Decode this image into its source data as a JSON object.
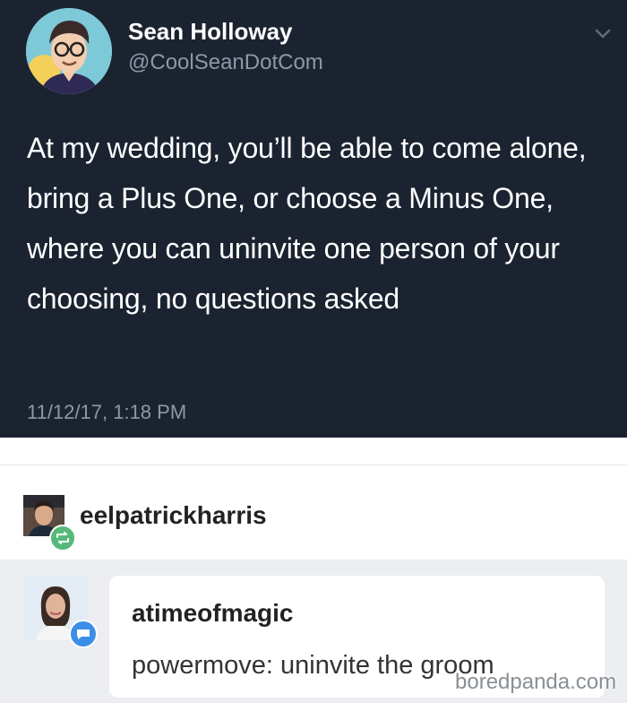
{
  "tweet": {
    "author_name": "Sean Holloway",
    "author_handle": "@CoolSeanDotCom",
    "text": "At my wedding, you’ll be able to come alone, bring a Plus One, or choose a Minus One, where you can uninvite one person of your choosing, no questions asked",
    "timestamp": "11/12/17, 1:18 PM",
    "menu_icon": "chevron-down-icon"
  },
  "reblog": {
    "username": "eelpatrickharris",
    "badge_icon": "reblog-icon",
    "badge_color": "#56b97a"
  },
  "comment": {
    "username": "atimeofmagic",
    "text": "powermove: uninvite the groom",
    "badge_icon": "comment-icon",
    "badge_color": "#3b8ee8"
  },
  "watermark": "boredpanda.com",
  "colors": {
    "tweet_background": "#1c2330",
    "tweet_secondary_text": "#8d98a7",
    "comment_background": "#eceef1"
  }
}
